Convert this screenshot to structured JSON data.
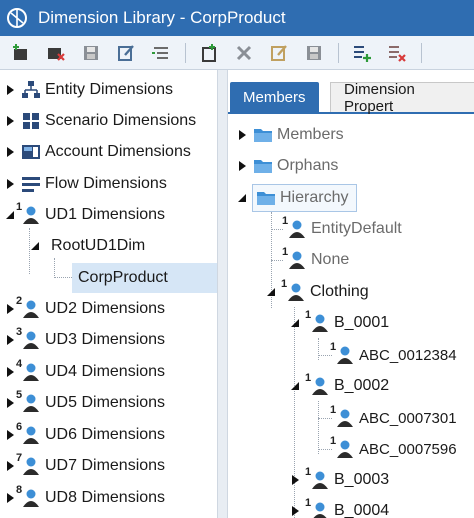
{
  "window": {
    "title": "Dimension Library - CorpProduct"
  },
  "toolbar": {
    "buttons": [
      "new-dimension-icon",
      "delete-dimension-icon",
      "save-dimension-icon",
      "edit-dimension-icon",
      "collapse-icon",
      "new-member-icon",
      "delete-member-icon",
      "rename-member-icon",
      "save-member-icon",
      "add-relationship-icon",
      "remove-relationship-icon"
    ]
  },
  "left_tree": {
    "items": [
      {
        "label": "Entity Dimensions",
        "icon": "entity-hierarchy-icon"
      },
      {
        "label": "Scenario Dimensions",
        "icon": "scenario-icon"
      },
      {
        "label": "Account Dimensions",
        "icon": "account-icon"
      },
      {
        "label": "Flow Dimensions",
        "icon": "flow-icon"
      },
      {
        "label": "UD1 Dimensions",
        "icon": "user-dimension-icon",
        "sup": "1"
      },
      {
        "label": "RootUD1Dim"
      },
      {
        "label": "CorpProduct"
      },
      {
        "label": "UD2 Dimensions",
        "icon": "user-dimension-icon",
        "sup": "2"
      },
      {
        "label": "UD3 Dimensions",
        "icon": "user-dimension-icon",
        "sup": "3"
      },
      {
        "label": "UD4 Dimensions",
        "icon": "user-dimension-icon",
        "sup": "4"
      },
      {
        "label": "UD5 Dimensions",
        "icon": "user-dimension-icon",
        "sup": "5"
      },
      {
        "label": "UD6 Dimensions",
        "icon": "user-dimension-icon",
        "sup": "6"
      },
      {
        "label": "UD7 Dimensions",
        "icon": "user-dimension-icon",
        "sup": "7"
      },
      {
        "label": "UD8 Dimensions",
        "icon": "user-dimension-icon",
        "sup": "8"
      }
    ]
  },
  "tabs": {
    "members": "Members",
    "properties": "Dimension Propert"
  },
  "member_tree": {
    "items": [
      {
        "label": "Members",
        "icon": "folder-icon"
      },
      {
        "label": "Orphans",
        "icon": "folder-icon"
      },
      {
        "label": "Hierarchy",
        "icon": "folder-icon"
      },
      {
        "label": "EntityDefault",
        "sup": "1"
      },
      {
        "label": "None",
        "sup": "1"
      },
      {
        "label": "Clothing",
        "sup": "1"
      },
      {
        "label": "B_0001",
        "sup": "1"
      },
      {
        "label": "ABC_0012384",
        "sup": "1"
      },
      {
        "label": "B_0002",
        "sup": "1"
      },
      {
        "label": "ABC_0007301",
        "sup": "1"
      },
      {
        "label": "ABC_0007596",
        "sup": "1"
      },
      {
        "label": "B_0003",
        "sup": "1"
      },
      {
        "label": "B_0004",
        "sup": "1"
      }
    ]
  },
  "colors": {
    "accent": "#2f6db1",
    "selection": "#d6e6f6",
    "member_icon": "#3d8fd6"
  }
}
